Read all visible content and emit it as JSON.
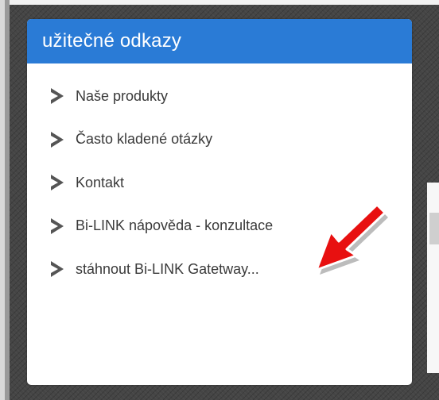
{
  "widget": {
    "title": "užitečné odkazy",
    "header_color": "#2a7bd6",
    "links": [
      {
        "label": "Naše produkty",
        "icon": "chevron-right-icon"
      },
      {
        "label": "Často kladené otázky",
        "icon": "chevron-right-icon"
      },
      {
        "label": "Kontakt",
        "icon": "chevron-right-icon"
      },
      {
        "label": "Bi-LINK nápověda - konzultace",
        "icon": "chevron-right-icon"
      },
      {
        "label": "stáhnout Bi-LINK Gatetway...",
        "icon": "chevron-right-icon"
      }
    ]
  },
  "annotation": {
    "icon": "red-arrow-icon",
    "color": "#e81010"
  }
}
